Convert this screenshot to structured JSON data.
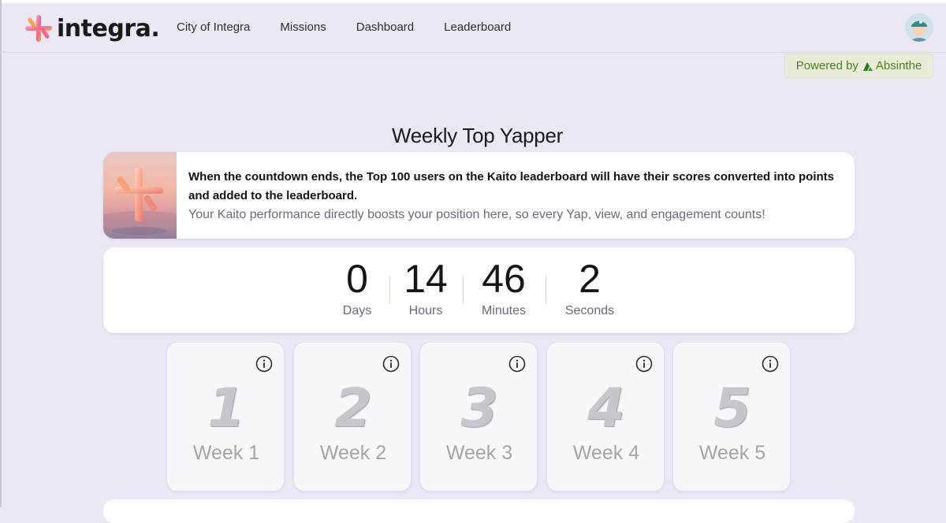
{
  "brand": {
    "logo_text": "integra."
  },
  "nav": {
    "items": [
      {
        "label": "City of Integra"
      },
      {
        "label": "Missions"
      },
      {
        "label": "Dashboard"
      },
      {
        "label": "Leaderboard"
      }
    ]
  },
  "powered": {
    "prefix": "Powered by",
    "brand": "Absinthe",
    "color": "#4f7d1e"
  },
  "page": {
    "title": "Weekly Top Yapper"
  },
  "info": {
    "headline": "When the countdown ends, the Top 100 users on the Kaito leaderboard will have their scores converted into points and added to the leaderboard.",
    "sub": "Your Kaito performance directly boosts your position here, so every Yap, view, and engagement counts!"
  },
  "countdown": {
    "days": {
      "value": "0",
      "label": "Days"
    },
    "hours": {
      "value": "14",
      "label": "Hours"
    },
    "minutes": {
      "value": "46",
      "label": "Minutes"
    },
    "seconds": {
      "value": "2",
      "label": "Seconds"
    }
  },
  "weeks": [
    {
      "number": "1",
      "label": "Week 1"
    },
    {
      "number": "2",
      "label": "Week 2"
    },
    {
      "number": "3",
      "label": "Week 3"
    },
    {
      "number": "4",
      "label": "Week 4"
    },
    {
      "number": "5",
      "label": "Week 5"
    }
  ],
  "colors": {
    "background": "#ece8f3",
    "card": "#ffffff",
    "accent_pink": "#f2628c",
    "accent_orange": "#f6a24a"
  }
}
